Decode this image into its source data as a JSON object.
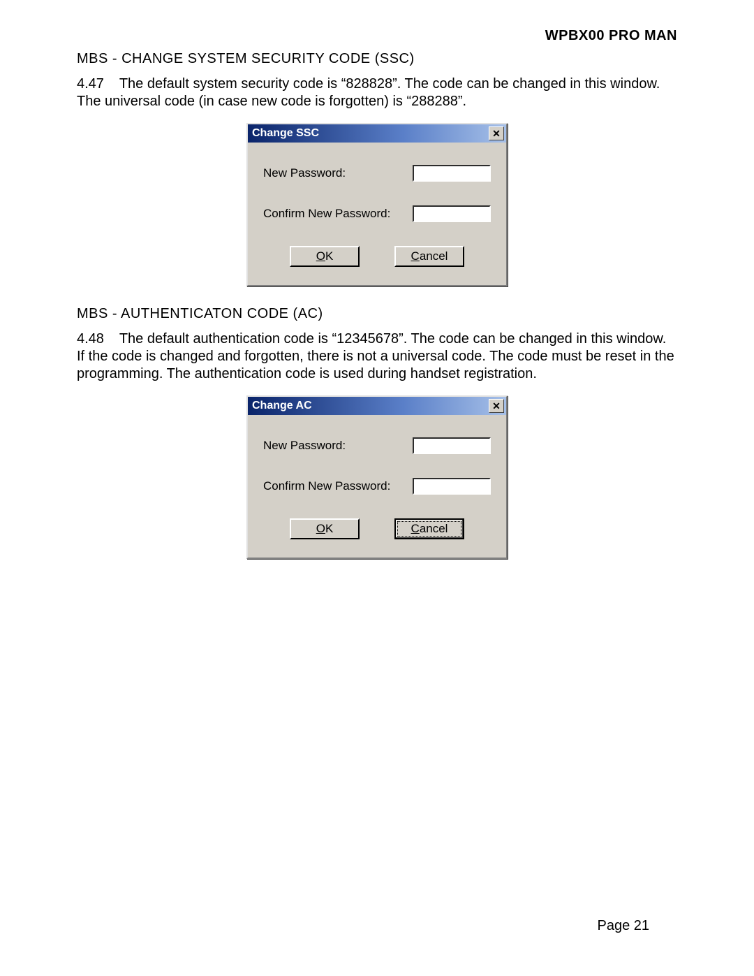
{
  "header": {
    "title": "WPBX00 PRO MAN"
  },
  "section1": {
    "heading": "MBS - CHANGE SYSTEM SECURITY CODE (SSC)",
    "para_num": "4.47",
    "para_text": "The default system security code is “828828”.  The code can be changed in this window.  The universal code (in case new code is forgotten) is “288288”."
  },
  "dialog1": {
    "title": "Change SSC",
    "close_glyph": "✕",
    "new_password_label": "New Password:",
    "confirm_password_label": "Confirm New Password:",
    "ok_mnemonic": "O",
    "ok_rest": "K",
    "cancel_mnemonic": "C",
    "cancel_rest": "ancel",
    "default_button": "ok"
  },
  "section2": {
    "heading": "MBS - AUTHENTICATON CODE (AC)",
    "para_num": "4.48",
    "para_text": "The default authentication  code is “12345678”.  The code can be changed in this window.  If the code is changed and forgotten, there is not a universal code.  The code must be reset in the programming.  The authentication code is used during handset registration."
  },
  "dialog2": {
    "title": "Change AC",
    "close_glyph": "✕",
    "new_password_label": "New Password:",
    "confirm_password_label": "Confirm New Password:",
    "ok_mnemonic": "O",
    "ok_rest": "K",
    "cancel_mnemonic": "C",
    "cancel_rest": "ancel",
    "default_button": "cancel"
  },
  "footer": {
    "page_label": "Page 21"
  }
}
